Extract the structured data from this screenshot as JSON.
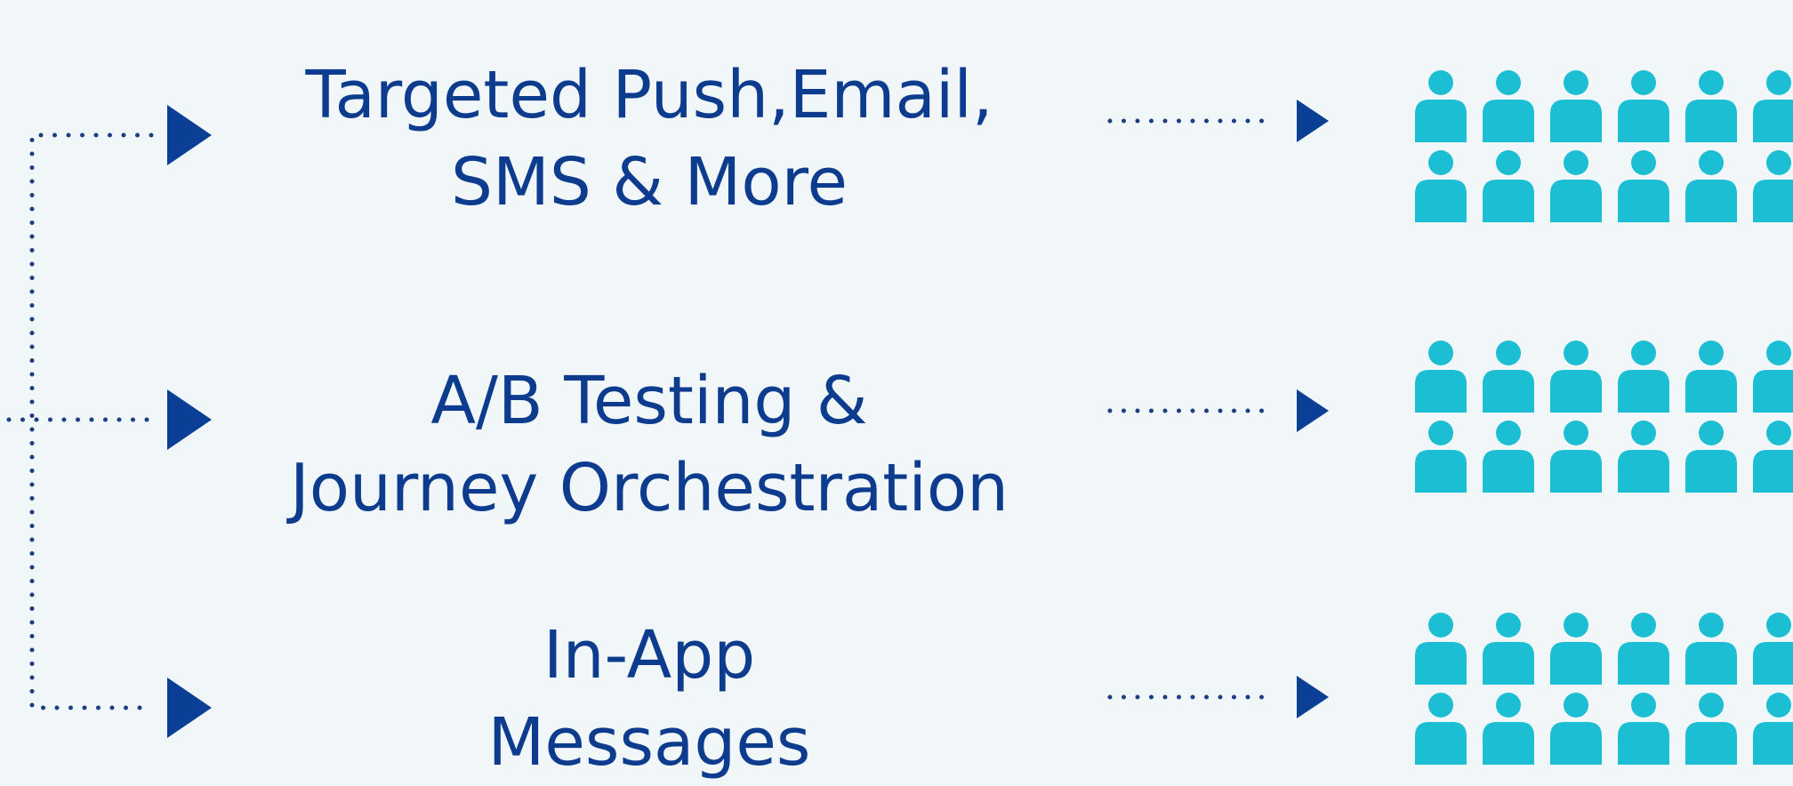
{
  "colors": {
    "background": "#f1f6f8",
    "text": "#0d3c8f",
    "arrow": "#0a3f95",
    "dots": "#1a3e7f",
    "audience": "#1cbed4"
  },
  "icon": "person-icon",
  "channels": [
    {
      "line1": "Targeted Push,Email,",
      "line2": "SMS & More"
    },
    {
      "line1": "A/B Testing &",
      "line2": "Journey Orchestration"
    },
    {
      "line1": "In-App",
      "line2": "Messages"
    }
  ]
}
